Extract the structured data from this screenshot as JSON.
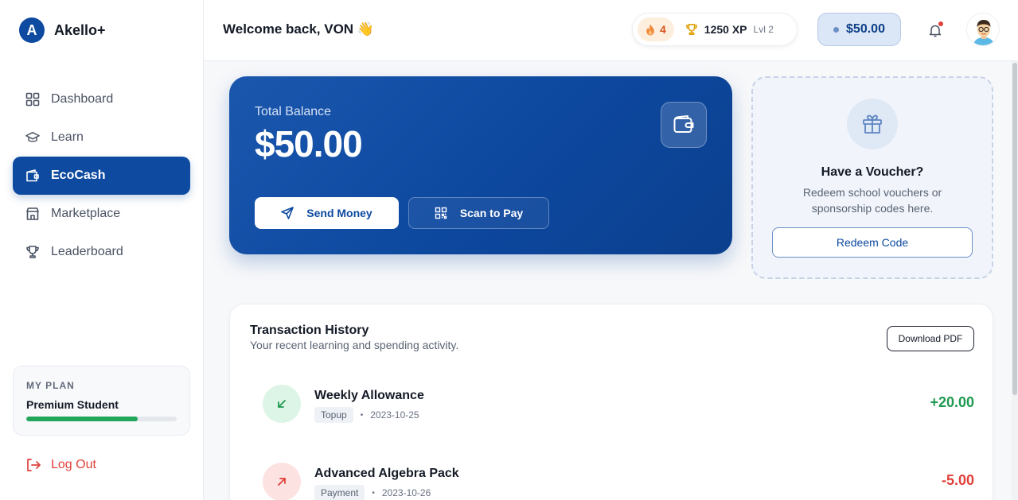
{
  "app": {
    "logo_letter": "A",
    "name": "Akello+"
  },
  "sidebar": {
    "items": [
      {
        "label": "Dashboard",
        "icon": "grid-icon",
        "active": false
      },
      {
        "label": "Learn",
        "icon": "graduation-cap-icon",
        "active": false
      },
      {
        "label": "EcoCash",
        "icon": "wallet-icon",
        "active": true
      },
      {
        "label": "Marketplace",
        "icon": "store-icon",
        "active": false
      },
      {
        "label": "Leaderboard",
        "icon": "trophy-icon",
        "active": false
      }
    ],
    "plan": {
      "label": "MY PLAN",
      "name": "Premium Student",
      "progress_percent": 74
    },
    "logout_label": "Log Out"
  },
  "header": {
    "welcome": "Welcome back, VON 👋",
    "streak": "4",
    "xp": "1250 XP",
    "level": "Lvl 2",
    "wallet_balance": "$50.00"
  },
  "balance_card": {
    "label": "Total Balance",
    "amount": "$50.00",
    "send_label": "Send Money",
    "scan_label": "Scan to Pay"
  },
  "voucher": {
    "title": "Have a Voucher?",
    "description": "Redeem school vouchers or sponsorship codes here.",
    "button_label": "Redeem Code"
  },
  "transactions": {
    "title": "Transaction History",
    "subtitle": "Your recent learning and spending activity.",
    "download_label": "Download PDF",
    "items": [
      {
        "name": "Weekly Allowance",
        "type": "Topup",
        "date": "2023-10-25",
        "amount": "+20.00",
        "direction": "in"
      },
      {
        "name": "Advanced Algebra Pack",
        "type": "Payment",
        "date": "2023-10-26",
        "amount": "-5.00",
        "direction": "out"
      }
    ]
  },
  "colors": {
    "primary": "#0d4aa0",
    "positive": "#1e9a50",
    "negative": "#e0403a",
    "progress": "#22a65a"
  }
}
